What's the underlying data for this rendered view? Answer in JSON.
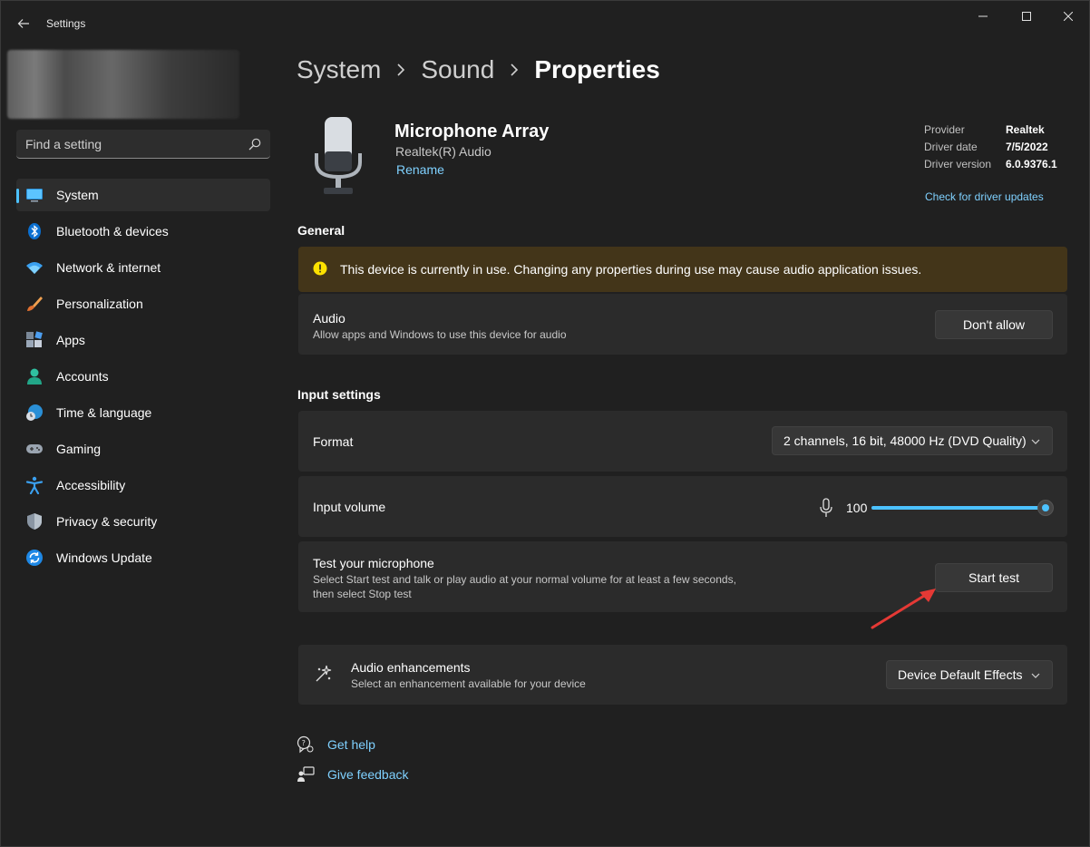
{
  "window": {
    "title": "Settings"
  },
  "search": {
    "placeholder": "Find a setting"
  },
  "sidebar": {
    "items": [
      {
        "label": "System",
        "icon": "monitor-icon",
        "active": true
      },
      {
        "label": "Bluetooth & devices",
        "icon": "bluetooth-icon"
      },
      {
        "label": "Network & internet",
        "icon": "wifi-icon"
      },
      {
        "label": "Personalization",
        "icon": "paintbrush-icon"
      },
      {
        "label": "Apps",
        "icon": "apps-icon"
      },
      {
        "label": "Accounts",
        "icon": "person-icon"
      },
      {
        "label": "Time & language",
        "icon": "globe-clock-icon"
      },
      {
        "label": "Gaming",
        "icon": "gamepad-icon"
      },
      {
        "label": "Accessibility",
        "icon": "accessibility-icon"
      },
      {
        "label": "Privacy & security",
        "icon": "shield-icon"
      },
      {
        "label": "Windows Update",
        "icon": "update-icon"
      }
    ]
  },
  "breadcrumb": {
    "items": [
      "System",
      "Sound",
      "Properties"
    ]
  },
  "device": {
    "name": "Microphone Array",
    "subtitle": "Realtek(R) Audio",
    "rename_label": "Rename",
    "driver": {
      "provider_label": "Provider",
      "provider_value": "Realtek",
      "date_label": "Driver date",
      "date_value": "7/5/2022",
      "version_label": "Driver version",
      "version_value": "6.0.9376.1",
      "update_link": "Check for driver updates"
    }
  },
  "general": {
    "title": "General",
    "warning": "This device is currently in use. Changing any properties during use may cause audio application issues.",
    "audio": {
      "title": "Audio",
      "description": "Allow apps and Windows to use this device for audio",
      "button_label": "Don't allow"
    }
  },
  "input_settings": {
    "title": "Input settings",
    "format": {
      "label": "Format",
      "value": "2 channels, 16 bit, 48000 Hz (DVD Quality)"
    },
    "volume": {
      "label": "Input volume",
      "value": "100",
      "level": 1.0
    },
    "test": {
      "title": "Test your microphone",
      "description_line1": "Select Start test and talk or play audio at your normal volume for at least a few seconds,",
      "description_line2": "then select Stop test",
      "button_label": "Start test"
    }
  },
  "enhancements": {
    "title": "Audio enhancements",
    "description": "Select an enhancement available for your device",
    "value": "Device Default Effects"
  },
  "help": {
    "get_help": "Get help",
    "give_feedback": "Give feedback"
  },
  "colors": {
    "accent": "#4cc2ff",
    "link": "#7fd1ff",
    "warning_bg": "#433519",
    "annotation_arrow": "#e53935"
  }
}
